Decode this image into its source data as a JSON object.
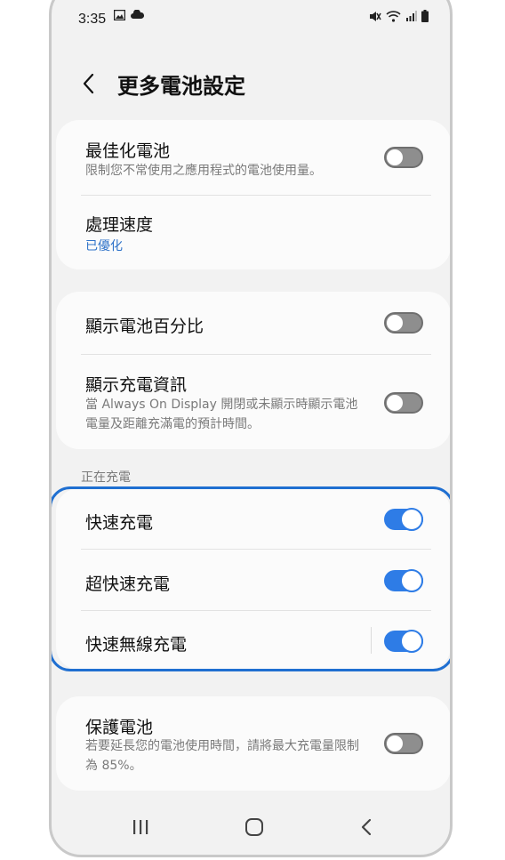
{
  "status_bar": {
    "time": "3:35"
  },
  "header": {
    "title": "更多電池設定"
  },
  "card1": {
    "optimize": {
      "title": "最佳化電池",
      "subtitle": "限制您不常使用之應用程式的電池使用量。",
      "enabled": false
    },
    "processing": {
      "title": "處理速度",
      "value": "已優化"
    }
  },
  "card2": {
    "show_percentage": {
      "title": "顯示電池百分比",
      "enabled": false
    },
    "show_charging_info": {
      "title": "顯示充電資訊",
      "subtitle": "當 Always On Display 開閉或未顯示時顯示電池電量及距離充滿電的預計時間。",
      "enabled": false
    }
  },
  "charging_section": {
    "label": "正在充電",
    "fast_charging": {
      "title": "快速充電",
      "enabled": true
    },
    "super_fast_charging": {
      "title": "超快速充電",
      "enabled": true
    },
    "fast_wireless_charging": {
      "title": "快速無線充電",
      "enabled": true
    }
  },
  "card4": {
    "protect_battery": {
      "title": "保護電池",
      "subtitle": "若要延長您的電池使用時間，請將最大充電量限制為 85%。",
      "enabled": false
    }
  },
  "colors": {
    "accent": "#2e7ce6",
    "highlight": "#1f6fd1",
    "link": "#2f73c9"
  },
  "nav": {
    "recent": "recent-apps-icon",
    "home": "home-icon",
    "back": "back-icon"
  }
}
